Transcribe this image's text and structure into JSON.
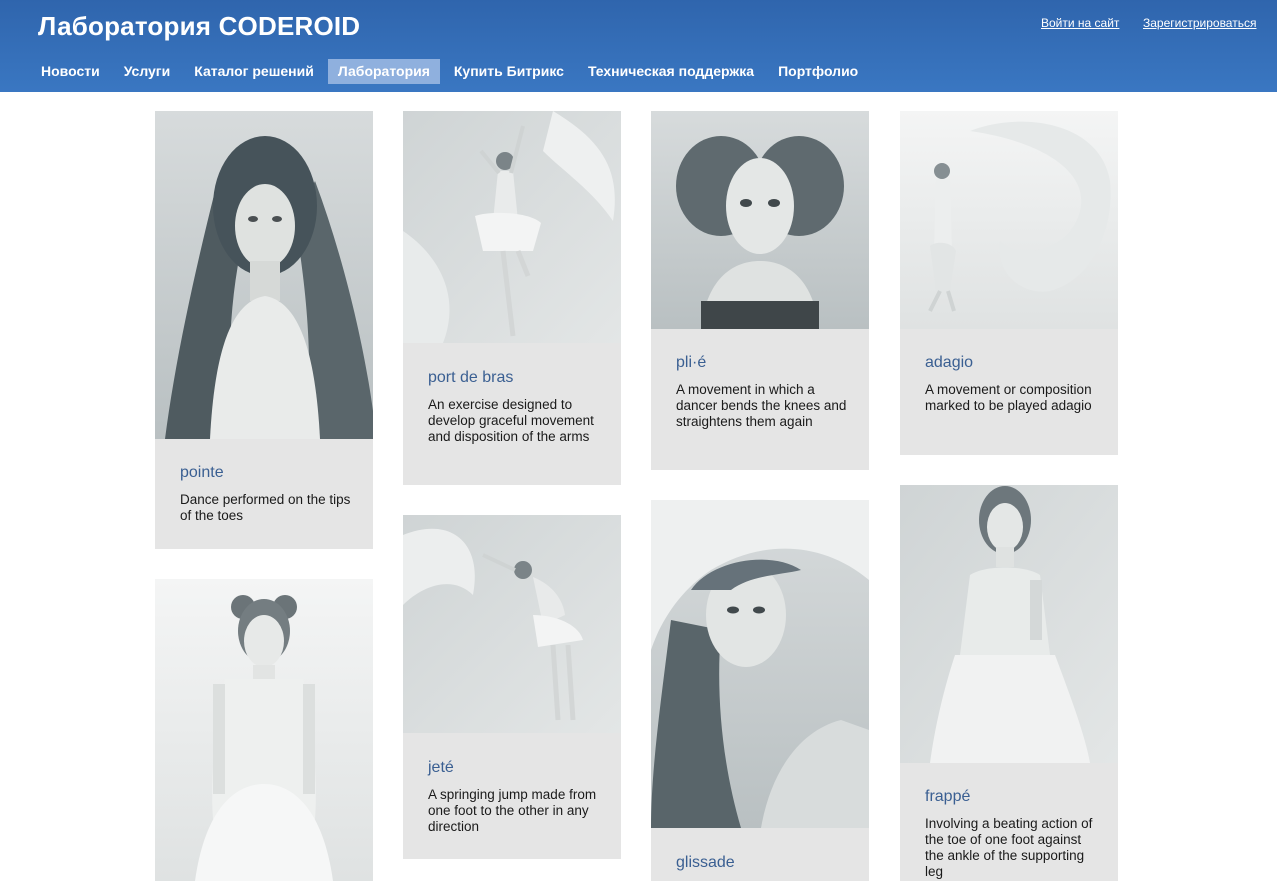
{
  "header": {
    "site_title": "Лаборатория CODEROID",
    "login_link": "Войти на сайт",
    "register_link": "Зарегистрироваться",
    "nav": [
      {
        "label": "Новости"
      },
      {
        "label": "Услуги"
      },
      {
        "label": "Каталог решений"
      },
      {
        "label": "Лаборатория"
      },
      {
        "label": "Купить Битрикс"
      },
      {
        "label": "Техническая поддержка"
      },
      {
        "label": "Портфолио"
      }
    ],
    "active_nav": "Лаборатория"
  },
  "colors": {
    "header_blue": "#3a77c2",
    "nav_active": "#8fb0de",
    "card_bg": "#e5e5e5",
    "title_blue": "#3a5f92"
  },
  "gallery": [
    {
      "title": "pointe",
      "description": "Dance performed on the tips of the toes"
    },
    {
      "title": "port de bras",
      "description": "An exercise designed to develop graceful movement and disposition of the arms"
    },
    {
      "title": "pli·é",
      "description": "A movement in which a dancer bends the knees and straightens them again"
    },
    {
      "title": "adagio",
      "description": "A movement or composition marked to be played adagio"
    },
    {
      "title": "",
      "description": ""
    },
    {
      "title": "jeté",
      "description": "A springing jump made from one foot to the other in any direction"
    },
    {
      "title": "glissade",
      "description": ""
    },
    {
      "title": "frappé",
      "description": "Involving a beating action of the toe of one foot against the ankle of the supporting leg"
    }
  ]
}
